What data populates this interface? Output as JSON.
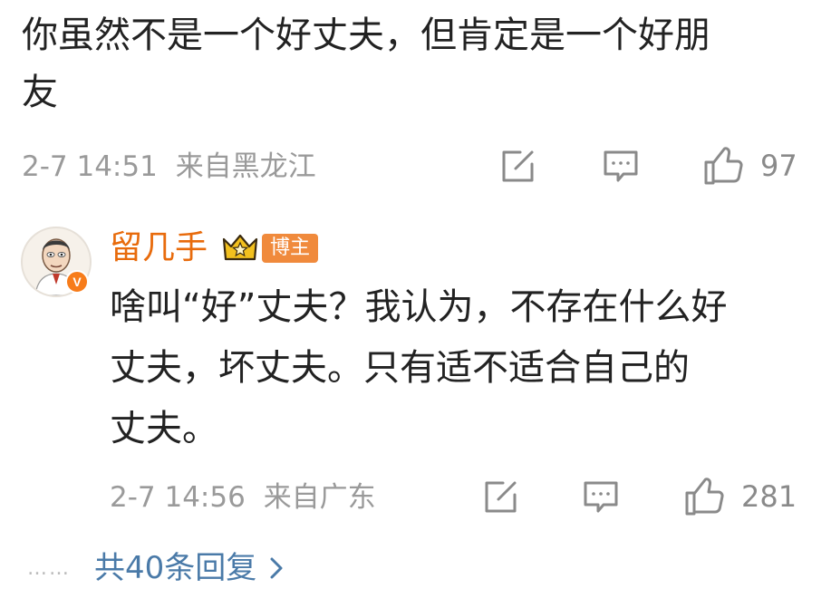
{
  "comment": {
    "lines": [
      "你虽然不是一个好丈夫，但肯定是一个好朋",
      "友"
    ],
    "timestamp": "2-7 14:51",
    "location": "来自黑龙江",
    "like_count": "97"
  },
  "reply": {
    "username": "留几手",
    "badge": "博主",
    "verified_mark": "V",
    "lines": [
      "啥叫“好”丈夫？我认为，不存在什么好",
      "丈夫，坏丈夫。只有适不适合自己的",
      "丈夫。"
    ],
    "timestamp": "2-7 14:56",
    "location": "来自广东",
    "like_count": "281"
  },
  "replies_link": {
    "dots": "……",
    "label": "共40条回复"
  },
  "colors": {
    "username": "#e86b0c",
    "badge_bg": "#f08a3c",
    "link": "#4a7aa8",
    "meta": "#9a9a9a"
  },
  "icons": [
    "share-icon",
    "comment-icon",
    "like-icon",
    "crown-icon",
    "chevron-right-icon",
    "verified-badge-icon"
  ]
}
